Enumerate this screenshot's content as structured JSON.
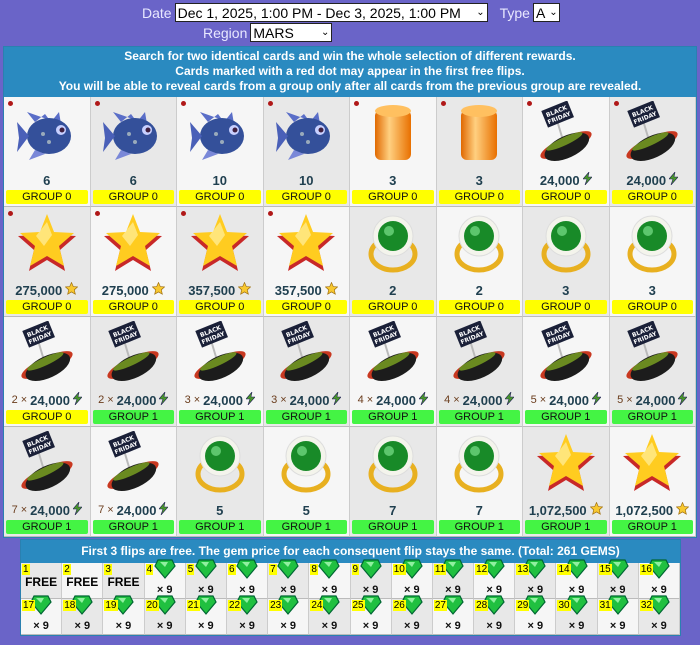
{
  "filters": {
    "date_label": "Date",
    "date_value": "Dec 1, 2025, 1:00 PM - Dec 3, 2025, 1:00 PM",
    "type_label": "Type",
    "type_value": "A",
    "region_label": "Region",
    "region_value": "MARS"
  },
  "board": {
    "instructions": [
      "Search for two identical cards and win the whole selection of different rewards.",
      "Cards marked with a red dot may appear in the first free flips.",
      "You will be able to reveal cards from a group only after all cards from the previous group are revealed."
    ],
    "cards": [
      {
        "icon": "fish",
        "value": "6",
        "group": "GROUP 0",
        "g": 0,
        "dot": true
      },
      {
        "icon": "fish",
        "value": "6",
        "group": "GROUP 0",
        "g": 0,
        "dot": true
      },
      {
        "icon": "fish",
        "value": "10",
        "group": "GROUP 0",
        "g": 0,
        "dot": true
      },
      {
        "icon": "fish",
        "value": "10",
        "group": "GROUP 0",
        "g": 0,
        "dot": true
      },
      {
        "icon": "cylinder",
        "value": "3",
        "group": "GROUP 0",
        "g": 0,
        "dot": true
      },
      {
        "icon": "cylinder",
        "value": "3",
        "group": "GROUP 0",
        "g": 0,
        "dot": true
      },
      {
        "icon": "hotdog",
        "value": "24,000",
        "unit": "energy",
        "group": "GROUP 0",
        "g": 0,
        "dot": true
      },
      {
        "icon": "hotdog",
        "value": "24,000",
        "unit": "energy",
        "group": "GROUP 0",
        "g": 0,
        "dot": true
      },
      {
        "icon": "star",
        "value": "275,000",
        "unit": "star",
        "group": "GROUP 0",
        "g": 0,
        "dot": true
      },
      {
        "icon": "star",
        "value": "275,000",
        "unit": "star",
        "group": "GROUP 0",
        "g": 0,
        "dot": true
      },
      {
        "icon": "star",
        "value": "357,500",
        "unit": "star",
        "group": "GROUP 0",
        "g": 0,
        "dot": true
      },
      {
        "icon": "star",
        "value": "357,500",
        "unit": "star",
        "group": "GROUP 0",
        "g": 0,
        "dot": true
      },
      {
        "icon": "ring",
        "value": "2",
        "group": "GROUP 0",
        "g": 0
      },
      {
        "icon": "ring",
        "value": "2",
        "group": "GROUP 0",
        "g": 0
      },
      {
        "icon": "ring",
        "value": "3",
        "group": "GROUP 0",
        "g": 0
      },
      {
        "icon": "ring",
        "value": "3",
        "group": "GROUP 0",
        "g": 0
      },
      {
        "icon": "hotdog",
        "mult": "2 ×",
        "value": "24,000",
        "unit": "energy",
        "group": "GROUP 0",
        "g": 0
      },
      {
        "icon": "hotdog",
        "mult": "2 ×",
        "value": "24,000",
        "unit": "energy",
        "group": "GROUP 1",
        "g": 1
      },
      {
        "icon": "hotdog",
        "mult": "3 ×",
        "value": "24,000",
        "unit": "energy",
        "group": "GROUP 1",
        "g": 1
      },
      {
        "icon": "hotdog",
        "mult": "3 ×",
        "value": "24,000",
        "unit": "energy",
        "group": "GROUP 1",
        "g": 1
      },
      {
        "icon": "hotdog",
        "mult": "4 ×",
        "value": "24,000",
        "unit": "energy",
        "group": "GROUP 1",
        "g": 1
      },
      {
        "icon": "hotdog",
        "mult": "4 ×",
        "value": "24,000",
        "unit": "energy",
        "group": "GROUP 1",
        "g": 1
      },
      {
        "icon": "hotdog",
        "mult": "5 ×",
        "value": "24,000",
        "unit": "energy",
        "group": "GROUP 1",
        "g": 1
      },
      {
        "icon": "hotdog",
        "mult": "5 ×",
        "value": "24,000",
        "unit": "energy",
        "group": "GROUP 1",
        "g": 1
      },
      {
        "icon": "hotdog",
        "mult": "7 ×",
        "value": "24,000",
        "unit": "energy",
        "group": "GROUP 1",
        "g": 1
      },
      {
        "icon": "hotdog",
        "mult": "7 ×",
        "value": "24,000",
        "unit": "energy",
        "group": "GROUP 1",
        "g": 1
      },
      {
        "icon": "ring",
        "value": "5",
        "group": "GROUP 1",
        "g": 1
      },
      {
        "icon": "ring",
        "value": "5",
        "group": "GROUP 1",
        "g": 1
      },
      {
        "icon": "ring",
        "value": "7",
        "group": "GROUP 1",
        "g": 1
      },
      {
        "icon": "ring",
        "value": "7",
        "group": "GROUP 1",
        "g": 1
      },
      {
        "icon": "star",
        "value": "1,072,500",
        "unit": "star",
        "group": "GROUP 1",
        "g": 1
      },
      {
        "icon": "star",
        "value": "1,072,500",
        "unit": "star",
        "group": "GROUP 1",
        "g": 1
      }
    ]
  },
  "flips": {
    "header": "First 3 flips are free. The gem price for each consequent flip stays the same. (Total: 261 GEMS)",
    "free_label": "FREE",
    "price_label": "× 9",
    "free_count": 3,
    "total_count": 32
  }
}
